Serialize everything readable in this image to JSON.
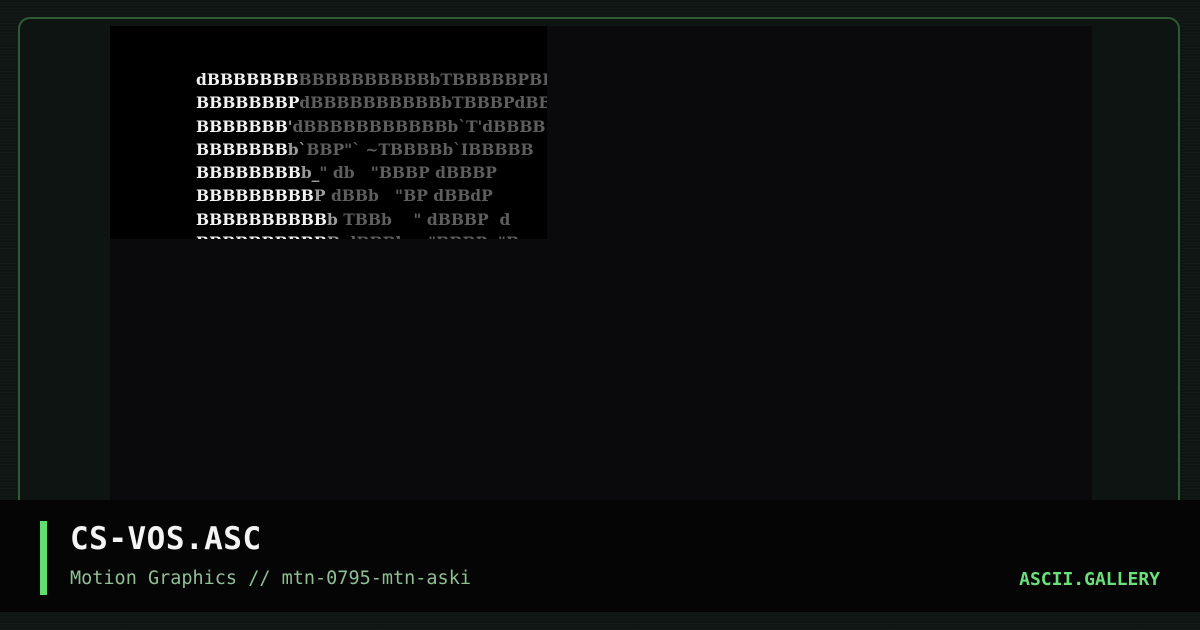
{
  "artwork": {
    "ascii_lines": [
      {
        "bright": "dBBBBBBB",
        "mid": "",
        "dim": "BBBBBBBBBBbTBBBBBPBBB"
      },
      {
        "bright": "BBBBBBBP",
        "mid": "",
        "dim": "dBBBBBBBBBBbTBBBPdBBB"
      },
      {
        "bright": "BBBBBBB",
        "mid": "'",
        "dim": "dBBBBBBBBBBBb`T'dBBBB"
      },
      {
        "bright": "BBBBBBB",
        "mid": "b`",
        "dim": "BBP\"` ~TBBBBb`IBBBBB"
      },
      {
        "bright": "BBBBBBBB",
        "mid": "b_",
        "dim": "\" db   \"BBBP dBBBP "
      },
      {
        "bright": "BBBBBBBBB",
        "mid": "P",
        "dim": " dBBb   \"BP dBBdP "
      },
      {
        "bright": "BBBBBBBBBB",
        "mid": "b",
        "dim": " TBBb    \" dBBBP  d"
      },
      {
        "bright": "BBBBBBBBBB",
        "mid": "B",
        "dim": " dBBBb    \"BBBP  \"B"
      }
    ]
  },
  "caption": {
    "title": "CS-VOS.ASC",
    "subtitle": "Motion Graphics // mtn-0795-mtn-aski",
    "brand": "ASCII.GALLERY"
  },
  "colors": {
    "accent": "#5fe06e",
    "border": "#2f5a36",
    "ascii_bright": "#f2f2f2",
    "ascii_dim": "#5e5e5e"
  }
}
